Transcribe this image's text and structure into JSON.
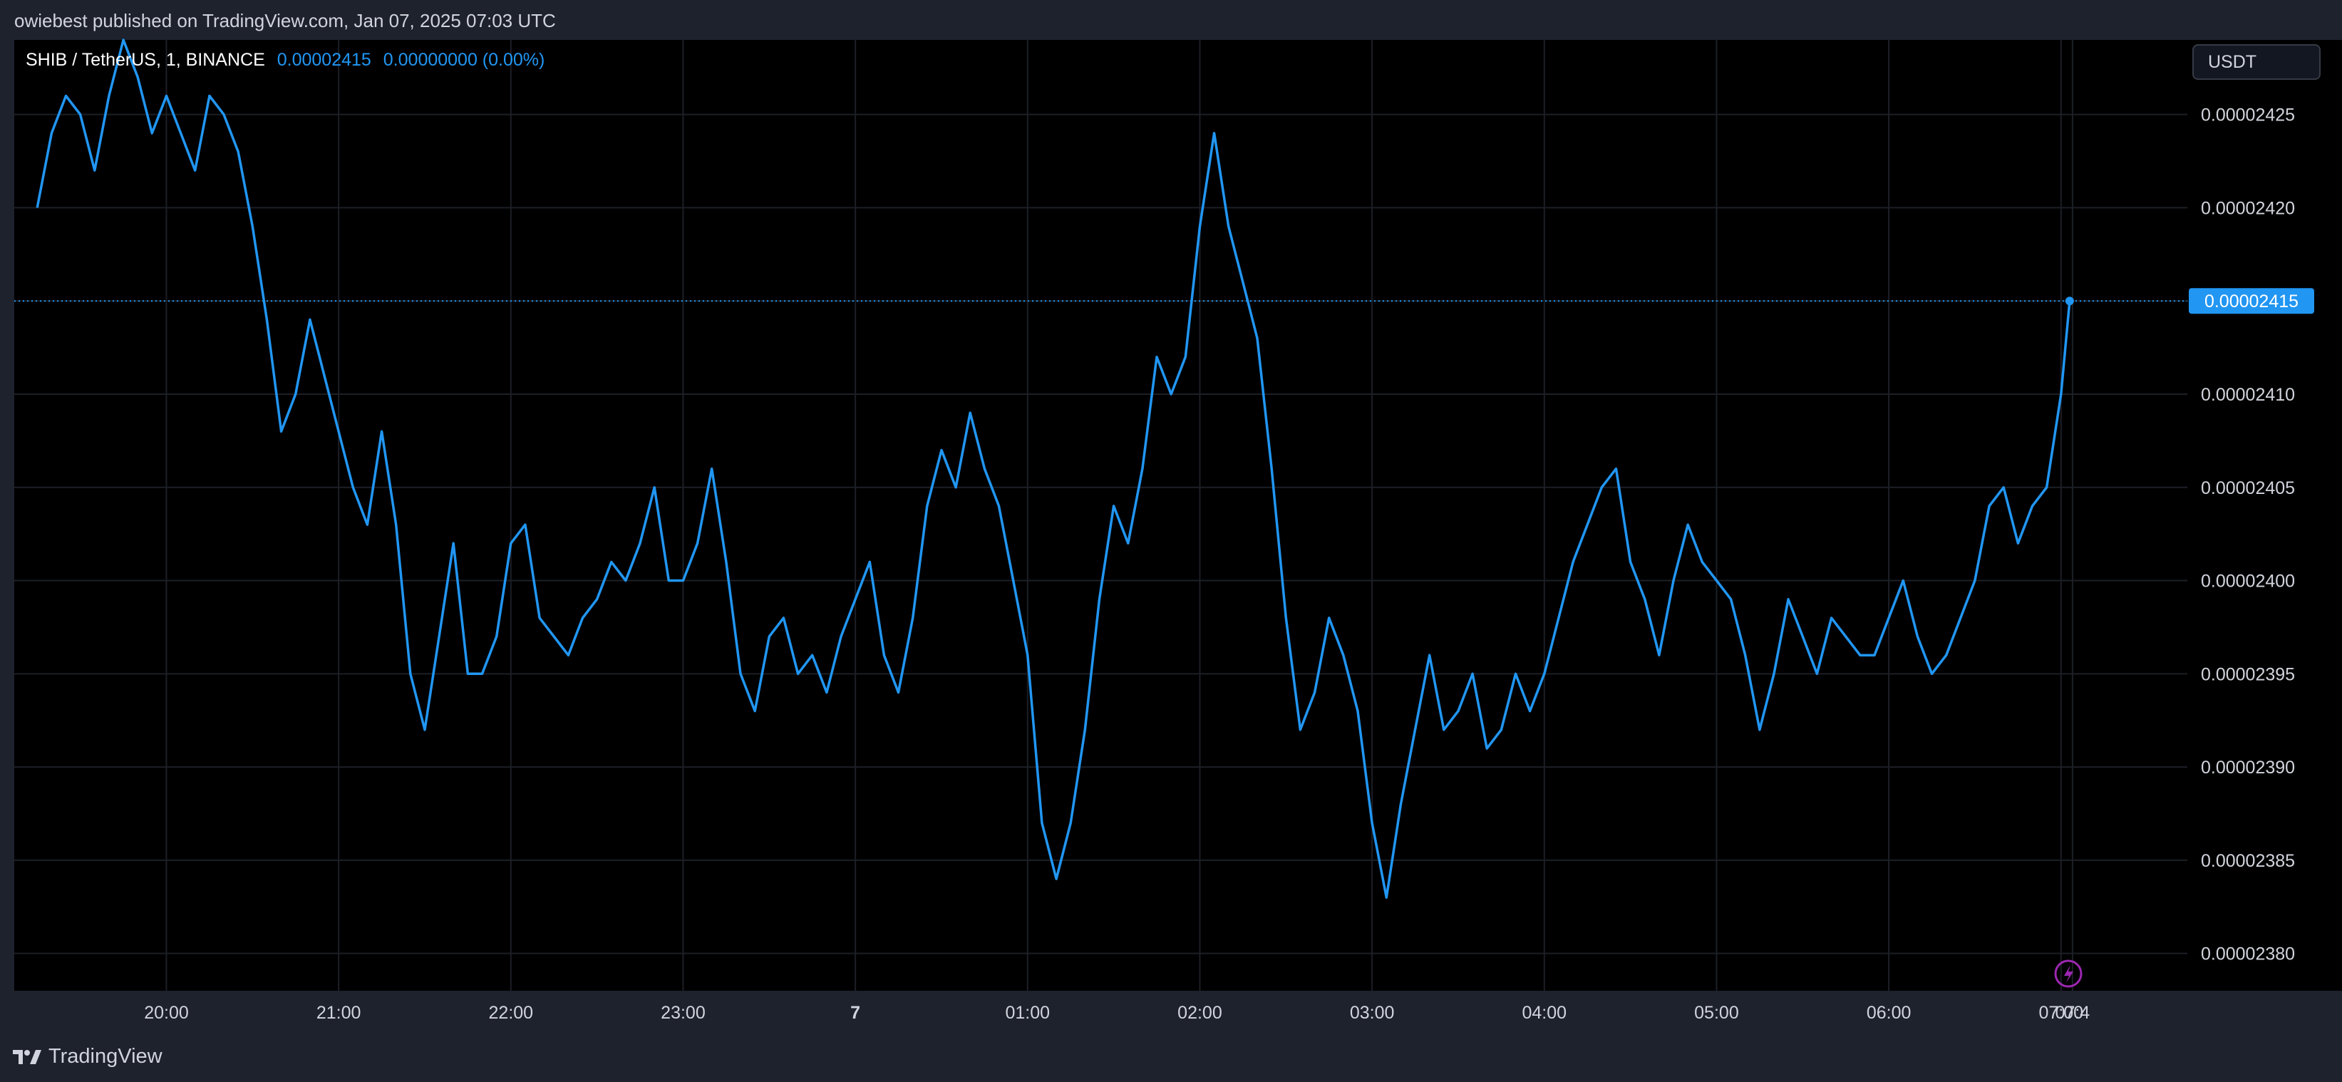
{
  "header": {
    "published_text": "owiebest published on TradingView.com, Jan 07, 2025 07:03 UTC"
  },
  "legend": {
    "symbol_text": "SHIB / TetherUS, 1, BINANCE",
    "price": "0.00002415",
    "change": "0.00000000 (0.00%)"
  },
  "currency_button": {
    "label": "USDT"
  },
  "footer": {
    "logo_text": "TradingView"
  },
  "icons": {
    "lightning": "lightning-icon",
    "logo": "tradingview-logo-icon"
  },
  "colors": {
    "line": "#2196f3",
    "background": "#000000",
    "frame": "#1e222d",
    "grid": "#1c1f26",
    "price_label_bg": "#2196f3",
    "event_icon": "#9c27b0"
  },
  "chart_data": {
    "type": "line",
    "series": [
      {
        "x": [
          "19:15",
          "19:20",
          "19:25",
          "19:30",
          "19:35",
          "19:40",
          "19:45",
          "19:50",
          "19:55",
          "20:00",
          "20:05",
          "20:10",
          "20:15",
          "20:20",
          "20:25",
          "20:30",
          "20:35",
          "20:40",
          "20:45",
          "20:50",
          "20:55",
          "21:00",
          "21:05",
          "21:10",
          "21:15",
          "21:20",
          "21:25",
          "21:30",
          "21:35",
          "21:40",
          "21:45",
          "21:50",
          "21:55",
          "22:00",
          "22:05",
          "22:10",
          "22:15",
          "22:20",
          "22:25",
          "22:30",
          "22:35",
          "22:40",
          "22:45",
          "22:50",
          "22:55",
          "23:00",
          "23:05",
          "23:10",
          "23:15",
          "23:20",
          "23:25",
          "23:30",
          "23:35",
          "23:40",
          "23:45",
          "23:50",
          "23:55",
          "00:00",
          "00:05",
          "00:10",
          "00:15",
          "00:20",
          "00:25",
          "00:30",
          "00:35",
          "00:40",
          "00:45",
          "00:50",
          "00:55",
          "01:00",
          "01:05",
          "01:10",
          "01:15",
          "01:20",
          "01:25",
          "01:30",
          "01:35",
          "01:40",
          "01:45",
          "01:50",
          "01:55",
          "02:00",
          "02:05",
          "02:10",
          "02:15",
          "02:20",
          "02:25",
          "02:30",
          "02:35",
          "02:40",
          "02:45",
          "02:50",
          "02:55",
          "03:00",
          "03:05",
          "03:10",
          "03:15",
          "03:20",
          "03:25",
          "03:30",
          "03:35",
          "03:40",
          "03:45",
          "03:50",
          "03:55",
          "04:00",
          "04:05",
          "04:10",
          "04:15",
          "04:20",
          "04:25",
          "04:30",
          "04:35",
          "04:40",
          "04:45",
          "04:50",
          "04:55",
          "05:00",
          "05:05",
          "05:10",
          "05:15",
          "05:20",
          "05:25",
          "05:30",
          "05:35",
          "05:40",
          "05:45",
          "05:50",
          "05:55",
          "06:00",
          "06:05",
          "06:10",
          "06:15",
          "06:20",
          "06:25",
          "06:30",
          "06:35",
          "06:40",
          "06:45",
          "06:50",
          "06:55",
          "07:00",
          "07:03"
        ],
        "values": [
          2.42e-05,
          2.424e-05,
          2.426e-05,
          2.425e-05,
          2.422e-05,
          2.426e-05,
          2.429e-05,
          2.427e-05,
          2.424e-05,
          2.426e-05,
          2.424e-05,
          2.422e-05,
          2.426e-05,
          2.425e-05,
          2.423e-05,
          2.419e-05,
          2.414e-05,
          2.408e-05,
          2.41e-05,
          2.414e-05,
          2.411e-05,
          2.408e-05,
          2.405e-05,
          2.403e-05,
          2.408e-05,
          2.403e-05,
          2.395e-05,
          2.392e-05,
          2.397e-05,
          2.402e-05,
          2.395e-05,
          2.395e-05,
          2.397e-05,
          2.402e-05,
          2.403e-05,
          2.398e-05,
          2.397e-05,
          2.396e-05,
          2.398e-05,
          2.399e-05,
          2.401e-05,
          2.4e-05,
          2.402e-05,
          2.405e-05,
          2.4e-05,
          2.4e-05,
          2.402e-05,
          2.406e-05,
          2.401e-05,
          2.395e-05,
          2.393e-05,
          2.397e-05,
          2.398e-05,
          2.395e-05,
          2.396e-05,
          2.394e-05,
          2.397e-05,
          2.399e-05,
          2.401e-05,
          2.396e-05,
          2.394e-05,
          2.398e-05,
          2.404e-05,
          2.407e-05,
          2.405e-05,
          2.409e-05,
          2.406e-05,
          2.404e-05,
          2.4e-05,
          2.396e-05,
          2.387e-05,
          2.384e-05,
          2.387e-05,
          2.392e-05,
          2.399e-05,
          2.404e-05,
          2.402e-05,
          2.406e-05,
          2.412e-05,
          2.41e-05,
          2.412e-05,
          2.419e-05,
          2.424e-05,
          2.419e-05,
          2.416e-05,
          2.413e-05,
          2.406e-05,
          2.398e-05,
          2.392e-05,
          2.394e-05,
          2.398e-05,
          2.396e-05,
          2.393e-05,
          2.387e-05,
          2.383e-05,
          2.388e-05,
          2.392e-05,
          2.396e-05,
          2.392e-05,
          2.393e-05,
          2.395e-05,
          2.391e-05,
          2.392e-05,
          2.395e-05,
          2.393e-05,
          2.395e-05,
          2.398e-05,
          2.401e-05,
          2.403e-05,
          2.405e-05,
          2.406e-05,
          2.401e-05,
          2.399e-05,
          2.396e-05,
          2.4e-05,
          2.403e-05,
          2.401e-05,
          2.4e-05,
          2.399e-05,
          2.396e-05,
          2.392e-05,
          2.395e-05,
          2.399e-05,
          2.397e-05,
          2.395e-05,
          2.398e-05,
          2.397e-05,
          2.396e-05,
          2.396e-05,
          2.398e-05,
          2.4e-05,
          2.397e-05,
          2.395e-05,
          2.396e-05,
          2.398e-05,
          2.4e-05,
          2.404e-05,
          2.405e-05,
          2.402e-05,
          2.404e-05,
          2.405e-05,
          2.41e-05,
          2.415e-05
        ]
      }
    ],
    "x_ticks": [
      "20:00",
      "21:00",
      "22:00",
      "23:00",
      "7",
      "01:00",
      "02:00",
      "03:00",
      "04:00",
      "05:00",
      "06:00",
      "07:00",
      "07:4"
    ],
    "y_ticks": [
      "0.00002425",
      "0.00002420",
      "0.00002415",
      "0.00002410",
      "0.00002405",
      "0.00002400",
      "0.00002395",
      "0.00002390",
      "0.00002385",
      "0.00002380"
    ],
    "ylim": [
      2.378e-05,
      2.429e-05
    ],
    "last_price_label": "0.00002415",
    "grid": true
  }
}
